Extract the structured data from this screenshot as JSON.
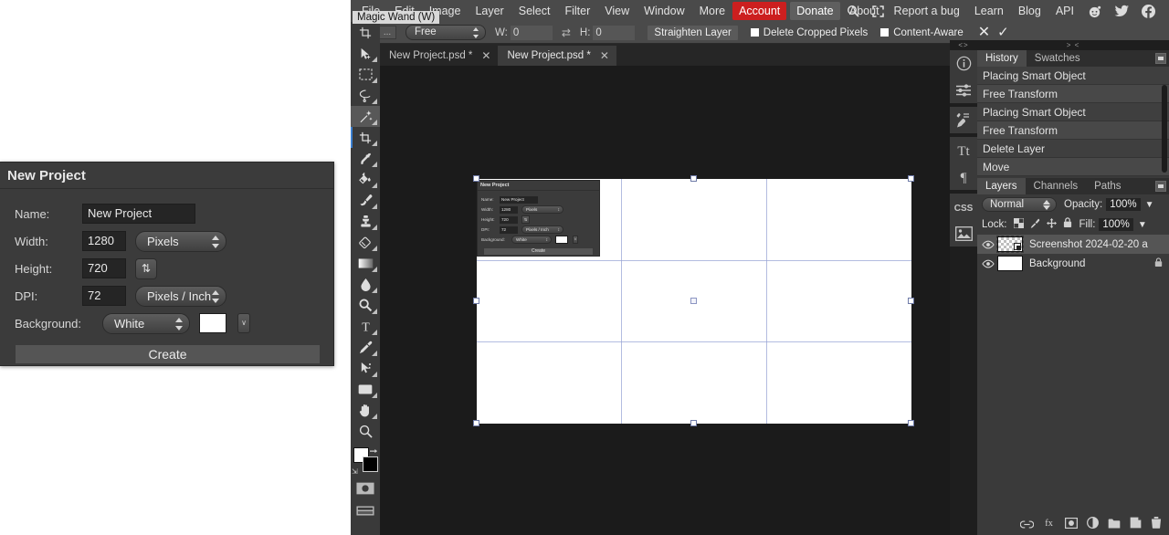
{
  "dialog": {
    "title": "New Project",
    "name_label": "Name:",
    "name_value": "New Project",
    "width_label": "Width:",
    "width_value": "1280",
    "width_unit": "Pixels",
    "height_label": "Height:",
    "height_value": "720",
    "swap_glyph": "⇅",
    "dpi_label": "DPI:",
    "dpi_value": "72",
    "dpi_unit": "Pixels / Inch",
    "background_label": "Background:",
    "background_value": "White",
    "background_color": "#ffffff",
    "more_glyph": "∨",
    "create_label": "Create"
  },
  "menubar": {
    "items": [
      "File",
      "Edit",
      "Image",
      "Layer",
      "Select",
      "Filter",
      "View",
      "Window",
      "More"
    ],
    "account": "Account",
    "donate": "Donate",
    "search_icon": "search-icon",
    "fullscreen_icon": "fullscreen-icon",
    "right_items": [
      "About",
      "Report a bug",
      "Learn",
      "Blog",
      "API"
    ],
    "social": [
      "reddit-icon",
      "twitter-icon",
      "facebook-icon"
    ],
    "tooltip": "Magic Wand (W)"
  },
  "options": {
    "tool_icon": "crop-icon",
    "overflow": "...",
    "ratio": "Free",
    "w_label": "W:",
    "w_value": "0",
    "swap_icon": "swap-icon",
    "h_label": "H:",
    "h_value": "0",
    "straighten": "Straighten Layer",
    "delete_cropped": "Delete Cropped Pixels",
    "content_aware": "Content-Aware",
    "cancel_glyph": "✕",
    "commit_glyph": "✓"
  },
  "toolbox": {
    "tools": [
      {
        "name": "crop-preview-tool",
        "hover": false,
        "active": false
      },
      {
        "name": "move-tool",
        "hover": false,
        "active": false
      },
      {
        "name": "rectangular-marquee-tool",
        "hover": false,
        "active": false
      },
      {
        "name": "lasso-tool",
        "hover": false,
        "active": false
      },
      {
        "name": "magic-wand-tool",
        "hover": true,
        "active": false
      },
      {
        "name": "crop-tool",
        "hover": false,
        "active": true
      },
      {
        "name": "eyedropper-tool",
        "hover": false,
        "active": false
      },
      {
        "name": "paint-bucket-tool",
        "hover": false,
        "active": false
      },
      {
        "name": "brush-tool",
        "hover": false,
        "active": false
      },
      {
        "name": "clone-stamp-tool",
        "hover": false,
        "active": false
      },
      {
        "name": "eraser-tool",
        "hover": false,
        "active": false
      },
      {
        "name": "gradient-tool",
        "hover": false,
        "active": false
      },
      {
        "name": "blur-tool",
        "hover": false,
        "active": false
      },
      {
        "name": "dodge-tool",
        "hover": false,
        "active": false
      },
      {
        "name": "type-tool",
        "hover": false,
        "active": false
      },
      {
        "name": "pen-tool",
        "hover": false,
        "active": false
      },
      {
        "name": "path-select-tool",
        "hover": false,
        "active": false
      },
      {
        "name": "shape-tool",
        "hover": false,
        "active": false
      },
      {
        "name": "hand-tool",
        "hover": false,
        "active": false
      },
      {
        "name": "zoom-tool",
        "hover": false,
        "active": false
      }
    ],
    "foreground_color": "#ffffff",
    "background_color": "#000000",
    "quickmask_icon": "quick-mask-icon",
    "screenmode_icon": "screen-mode-icon"
  },
  "tabs": [
    {
      "label": "New Project.psd *",
      "active": false
    },
    {
      "label": "New Project.psd *",
      "active": true
    }
  ],
  "canvas": {
    "mini": {
      "title": "New Project",
      "name_label": "Name:",
      "name_value": "New Project",
      "width_label": "Width:",
      "width_value": "1280",
      "width_unit": "Pixels",
      "height_label": "Height:",
      "height_value": "720",
      "dpi_label": "DPI:",
      "dpi_value": "72",
      "dpi_unit": "Pixels / Inch",
      "background_label": "Background:",
      "background_value": "White",
      "create_label": "Create"
    }
  },
  "rail": {
    "expand_glyph": "<>",
    "buttons": [
      "info-icon",
      "adjustments-icon",
      "brush-presets-icon",
      "character-icon",
      "paragraph-icon",
      "css-icon",
      "image-icon"
    ]
  },
  "panels": {
    "collapse_glyph": "> <",
    "top_tabs": [
      {
        "label": "History",
        "active": true
      },
      {
        "label": "Swatches",
        "active": false
      }
    ],
    "history": [
      "Placing Smart Object",
      "Free Transform",
      "Placing Smart Object",
      "Free Transform",
      "Delete Layer",
      "Move"
    ],
    "bottom_tabs": [
      {
        "label": "Layers",
        "active": true
      },
      {
        "label": "Channels",
        "active": false
      },
      {
        "label": "Paths",
        "active": false
      }
    ],
    "blend_mode": "Normal",
    "opacity_label": "Opacity:",
    "opacity_value": "100%",
    "lock_label": "Lock:",
    "lock_icons": [
      "lock-transparency-icon",
      "lock-pixels-icon",
      "lock-position-icon",
      "lock-all-icon"
    ],
    "fill_label": "Fill:",
    "fill_value": "100%",
    "layers": [
      {
        "name": "Screenshot 2024-02-20 a",
        "selected": true,
        "locked": false,
        "kind": "smart-object"
      },
      {
        "name": "Background",
        "selected": false,
        "locked": true,
        "kind": "raster"
      }
    ],
    "footer_icons": [
      "link-layers-icon",
      "layer-style-icon",
      "layer-mask-icon",
      "adjustment-layer-icon",
      "new-group-icon",
      "new-layer-icon",
      "delete-layer-icon"
    ]
  }
}
